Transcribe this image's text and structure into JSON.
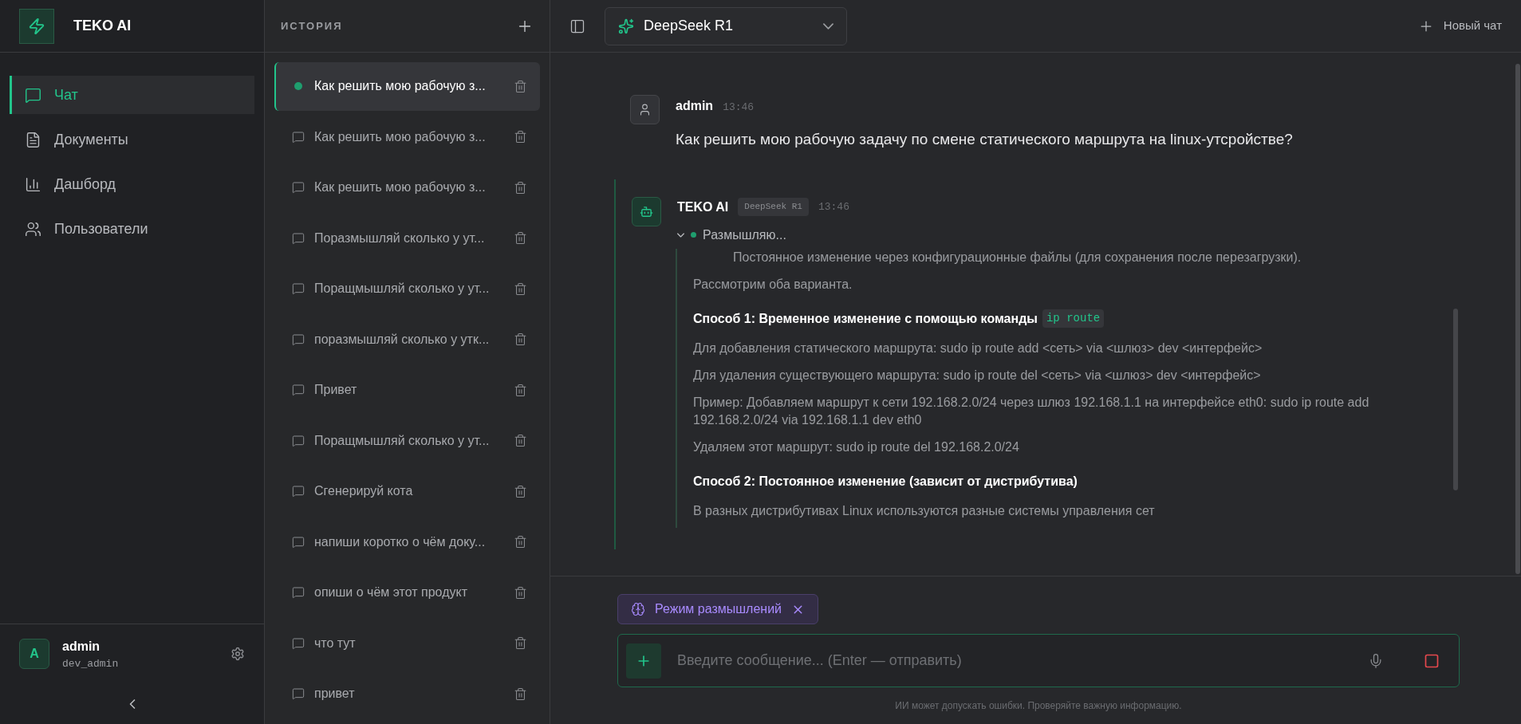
{
  "sidebar": {
    "logo": "TEKO AI",
    "nav": [
      {
        "label": "Чат",
        "selected": true
      },
      {
        "label": "Документы",
        "selected": false
      },
      {
        "label": "Дашборд",
        "selected": false
      },
      {
        "label": "Пользователи",
        "selected": false
      }
    ],
    "user": {
      "avatar": "A",
      "name": "admin",
      "handle": "dev_admin"
    }
  },
  "history": {
    "title": "ИСТОРИЯ",
    "items": [
      {
        "title": "Как решить мою рабочую з...",
        "selected": true
      },
      {
        "title": "Как решить мою рабочую з...",
        "selected": false
      },
      {
        "title": "Как решить мою рабочую з...",
        "selected": false
      },
      {
        "title": "Поразмышляй сколько у ут...",
        "selected": false
      },
      {
        "title": "Поращмышляй сколько у ут...",
        "selected": false
      },
      {
        "title": "поразмышляй сколько у утк...",
        "selected": false
      },
      {
        "title": "Привет",
        "selected": false
      },
      {
        "title": "Поращмышляй сколько у ут...",
        "selected": false
      },
      {
        "title": "Сгенерируй кота",
        "selected": false
      },
      {
        "title": "напиши коротко о чём доку...",
        "selected": false
      },
      {
        "title": "опиши о чём этот продукт",
        "selected": false
      },
      {
        "title": "что тут",
        "selected": false
      },
      {
        "title": "привет",
        "selected": false
      }
    ]
  },
  "topbar": {
    "model": "DeepSeek R1",
    "new_chat": "Новый чат"
  },
  "messages": {
    "user": {
      "author": "admin",
      "time": "13:46",
      "text": "Как решить мою рабочую задачу по смене статического маршрута на linux-утсройстве?"
    },
    "assistant": {
      "author": "TEKO AI",
      "model_tag": "DeepSeek R1",
      "time": "13:46",
      "thinking": {
        "label": "Размышляю...",
        "expanded": true,
        "lines": [
          {
            "kind": "indented",
            "text": "Постоянное изменение через конфигурационные файлы (для сохранения после перезагрузки)."
          },
          {
            "kind": "text",
            "text": "Рассмотрим оба варианта."
          },
          {
            "kind": "heading",
            "text": "Способ 1: Временное изменение с помощью команды",
            "code": "ip route"
          },
          {
            "kind": "text",
            "text": "Для добавления статического маршрута: sudo ip route add <сеть> via <шлюз> dev <интерфейс>"
          },
          {
            "kind": "text",
            "text": "Для удаления существующего маршрута: sudo ip route del <сеть> via <шлюз> dev <интерфейс>"
          },
          {
            "kind": "text",
            "text": "Пример: Добавляем маршрут к сети 192.168.2.0/24 через шлюз 192.168.1.1 на интерфейсе eth0: sudo ip route add 192.168.2.0/24 via 192.168.1.1 dev eth0"
          },
          {
            "kind": "text",
            "text": "Удаляем этот маршрут: sudo ip route del 192.168.2.0/24"
          },
          {
            "kind": "heading",
            "text": "Способ 2: Постоянное изменение (зависит от дистрибутива)"
          },
          {
            "kind": "text",
            "text": "В разных дистрибутивах Linux используются разные системы управления сет"
          }
        ]
      }
    }
  },
  "composer": {
    "chip": "Режим размышлений",
    "placeholder": "Введите сообщение... (Enter — отправить)",
    "disclaimer": "ИИ может допускать ошибки. Проверяйте важную информацию."
  }
}
